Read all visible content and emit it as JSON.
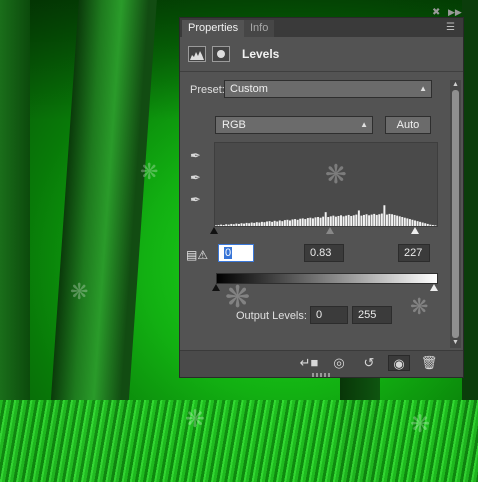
{
  "panel": {
    "tabs": [
      {
        "label": "Properties",
        "active": true
      },
      {
        "label": "Info",
        "active": false
      }
    ],
    "title": "Levels",
    "preset_label": "Preset:",
    "preset_value": "Custom",
    "channel_value": "RGB",
    "auto_label": "Auto",
    "input_levels": {
      "black": "0",
      "gamma": "0.83",
      "white": "227"
    },
    "output_label": "Output Levels:",
    "output_levels": {
      "black": "0",
      "white": "255"
    }
  },
  "histogram": {
    "bins": [
      2,
      3,
      4,
      3,
      5,
      4,
      6,
      5,
      7,
      6,
      8,
      7,
      9,
      8,
      10,
      9,
      11,
      10,
      12,
      11,
      13,
      14,
      12,
      15,
      13,
      16,
      14,
      17,
      18,
      16,
      19,
      20,
      18,
      21,
      22,
      20,
      23,
      24,
      22,
      25,
      26,
      24,
      27,
      40,
      26,
      28,
      30,
      27,
      29,
      31,
      28,
      30,
      32,
      29,
      31,
      33,
      45,
      30,
      32,
      34,
      31,
      33,
      35,
      32,
      34,
      36,
      60,
      33,
      35,
      34,
      32,
      30,
      28,
      26,
      24,
      22,
      20,
      18,
      16,
      14,
      12,
      10,
      8,
      6,
      4,
      3,
      2
    ]
  },
  "colors": {
    "panel_bg": "#535353",
    "tabbar_bg": "#3a3a3a",
    "field_bg": "#3b3b3b",
    "highlight": "#3875d7"
  },
  "icons": {
    "close": "close-icon",
    "collapse": "collapse-icon",
    "flyout": "flyout-menu-icon"
  }
}
